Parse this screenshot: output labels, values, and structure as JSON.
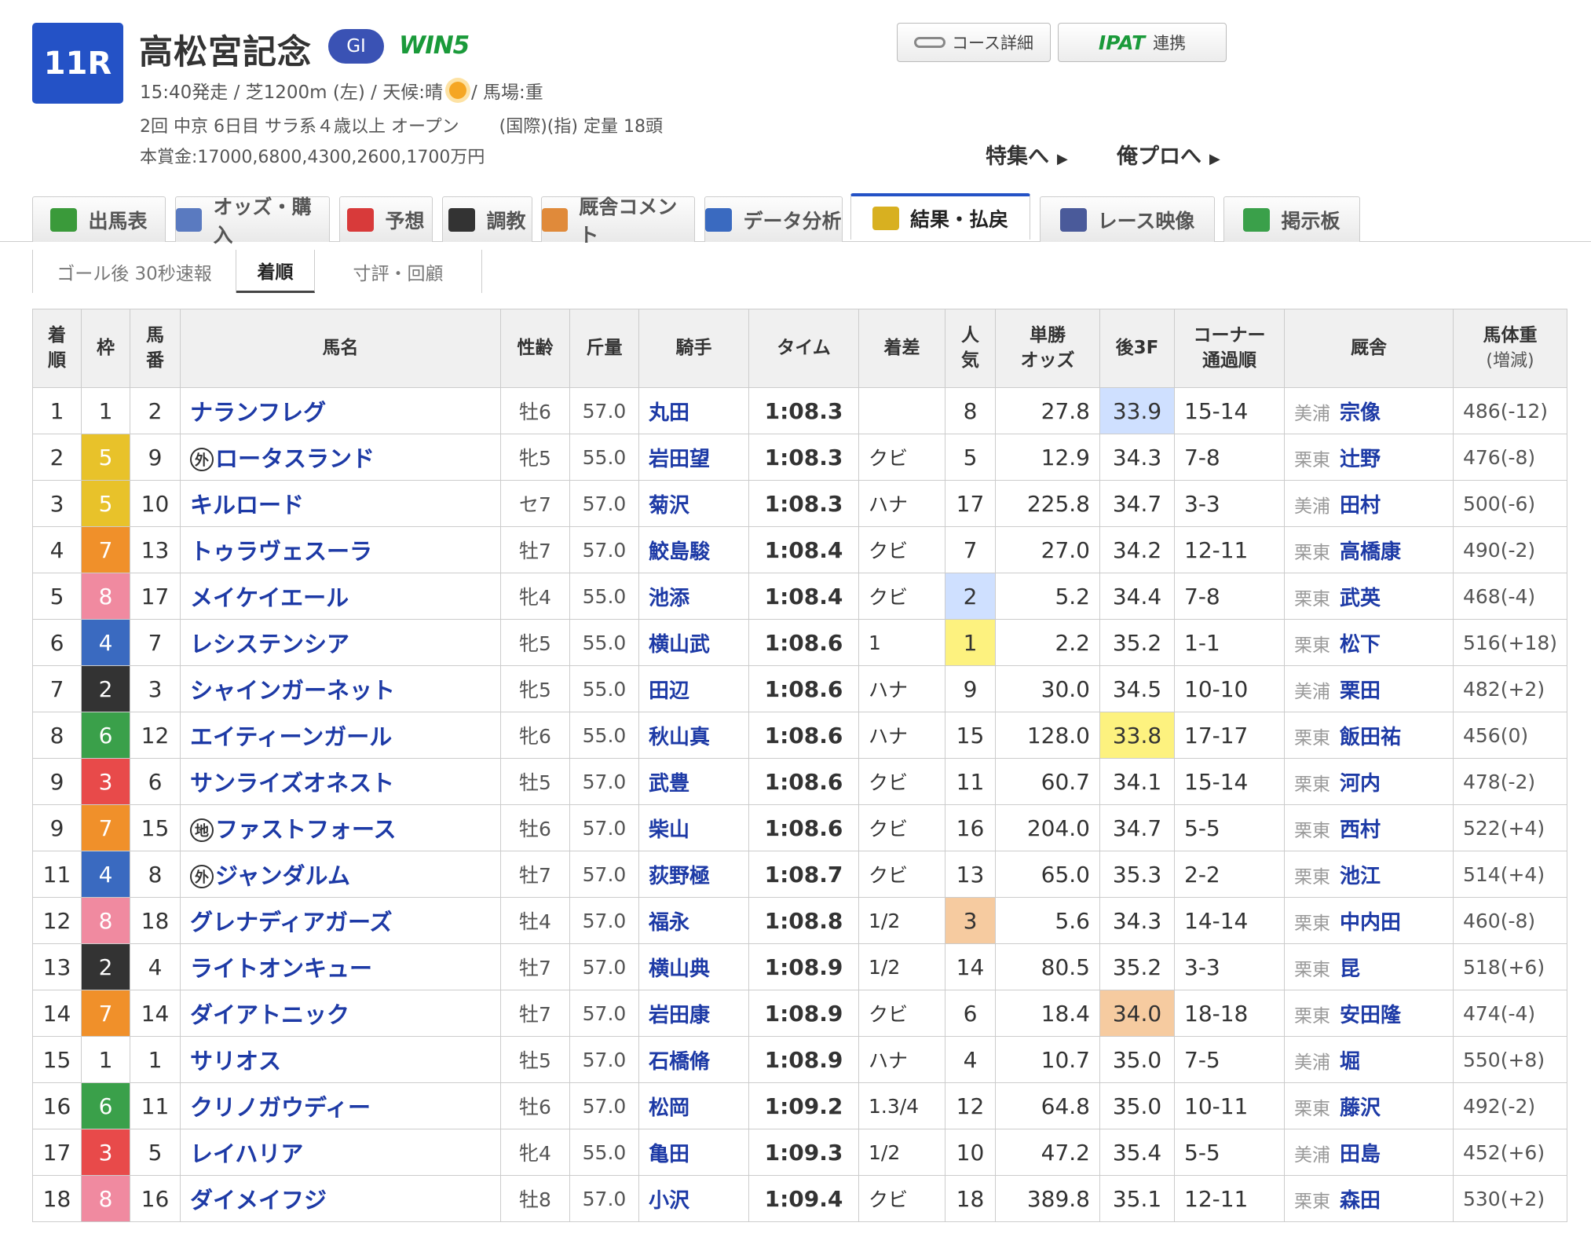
{
  "race": {
    "number": "11R",
    "title": "高松宮記念",
    "grade": "GI",
    "win5": "WIN5",
    "info_start": "15:40発走 / 芝1200m (左) / 天候:晴",
    "weather_icon": "sun-icon",
    "info_track": " / 馬場:重",
    "conditions": "2回 中京 6日目 サラ系４歳以上 オープン 　　(国際)(指) 定量 18頭",
    "prize": "本賞金:17000,6800,4300,2600,1700万円"
  },
  "buttons": {
    "course": "コース詳細",
    "ipat_logo": "IPAT",
    "ipat": "連携",
    "tokushu": "特集へ",
    "orepro": "俺プロへ"
  },
  "tabs": [
    {
      "label": "出馬表",
      "icon": "entry-table-icon",
      "color": "#3a9a3a"
    },
    {
      "label": "オッズ・購入",
      "icon": "odds-icon",
      "color": "#5a7ac0"
    },
    {
      "label": "予想",
      "icon": "target-icon",
      "color": "#d83a3a"
    },
    {
      "label": "調教",
      "icon": "stopwatch-icon",
      "color": "#333333"
    },
    {
      "label": "厩舎コメント",
      "icon": "stable-icon",
      "color": "#e08a3a"
    },
    {
      "label": "データ分析",
      "icon": "bar-chart-icon",
      "color": "#3a6ac0"
    },
    {
      "label": "結果・払戻",
      "icon": "coins-icon",
      "color": "#d8b020"
    },
    {
      "label": "レース映像",
      "icon": "video-icon",
      "color": "#4a5a9a"
    },
    {
      "label": "掲示板",
      "icon": "chat-icon",
      "color": "#3aa04a"
    }
  ],
  "subtabs": [
    "ゴール後 30秒速報",
    "着順",
    "寸評・回顧"
  ],
  "table": {
    "headers": {
      "rank": [
        "着",
        "順"
      ],
      "waku": "枠",
      "num": [
        "馬",
        "番"
      ],
      "horse": "馬名",
      "sexage": "性齢",
      "weight": "斤量",
      "jockey": "騎手",
      "time": "タイム",
      "margin": "着差",
      "pop": [
        "人",
        "気"
      ],
      "odds": [
        "単勝",
        "オッズ"
      ],
      "last3f": "後3F",
      "corner": [
        "コーナー",
        "通過順"
      ],
      "trainer": "厩舎",
      "body": [
        "馬体重",
        "(増減)"
      ]
    },
    "waku_colors": {
      "1": {
        "bg": "#ffffff",
        "fg": "#333333"
      },
      "2": {
        "bg": "#333333",
        "fg": "#ffffff"
      },
      "3": {
        "bg": "#e84a4a",
        "fg": "#ffffff"
      },
      "4": {
        "bg": "#3a6ac0",
        "fg": "#ffffff"
      },
      "5": {
        "bg": "#e8c22a",
        "fg": "#ffffff"
      },
      "6": {
        "bg": "#3aa04a",
        "fg": "#ffffff"
      },
      "7": {
        "bg": "#f0902a",
        "fg": "#ffffff"
      },
      "8": {
        "bg": "#f08aa0",
        "fg": "#ffffff"
      }
    },
    "rows": [
      {
        "rank": "1",
        "waku": "1",
        "num": "2",
        "mark": "",
        "horse": "ナランフレグ",
        "sexage": "牡6",
        "weight": "57.0",
        "jockey": "丸田",
        "time": "1:08.3",
        "margin": "",
        "pop": "8",
        "odds": "27.8",
        "last3f": "33.9",
        "corner": "15-14",
        "area": "美浦",
        "trainer": "宗像",
        "body": "486(-12)"
      },
      {
        "rank": "2",
        "waku": "5",
        "num": "9",
        "mark": "外",
        "horse": "ロータスランド",
        "sexage": "牝5",
        "weight": "55.0",
        "jockey": "岩田望",
        "time": "1:08.3",
        "margin": "クビ",
        "pop": "5",
        "odds": "12.9",
        "last3f": "34.3",
        "corner": "7-8",
        "area": "栗東",
        "trainer": "辻野",
        "body": "476(-8)"
      },
      {
        "rank": "3",
        "waku": "5",
        "num": "10",
        "mark": "",
        "horse": "キルロード",
        "sexage": "セ7",
        "weight": "57.0",
        "jockey": "菊沢",
        "time": "1:08.3",
        "margin": "ハナ",
        "pop": "17",
        "odds": "225.8",
        "last3f": "34.7",
        "corner": "3-3",
        "area": "美浦",
        "trainer": "田村",
        "body": "500(-6)"
      },
      {
        "rank": "4",
        "waku": "7",
        "num": "13",
        "mark": "",
        "horse": "トゥラヴェスーラ",
        "sexage": "牡7",
        "weight": "57.0",
        "jockey": "鮫島駿",
        "time": "1:08.4",
        "margin": "クビ",
        "pop": "7",
        "odds": "27.0",
        "last3f": "34.2",
        "corner": "12-11",
        "area": "栗東",
        "trainer": "高橋康",
        "body": "490(-2)"
      },
      {
        "rank": "5",
        "waku": "8",
        "num": "17",
        "mark": "",
        "horse": "メイケイエール",
        "sexage": "牝4",
        "weight": "55.0",
        "jockey": "池添",
        "time": "1:08.4",
        "margin": "クビ",
        "pop": "2",
        "odds": "5.2",
        "last3f": "34.4",
        "corner": "7-8",
        "area": "栗東",
        "trainer": "武英",
        "body": "468(-4)"
      },
      {
        "rank": "6",
        "waku": "4",
        "num": "7",
        "mark": "",
        "horse": "レシステンシア",
        "sexage": "牝5",
        "weight": "55.0",
        "jockey": "横山武",
        "time": "1:08.6",
        "margin": "1",
        "pop": "1",
        "odds": "2.2",
        "last3f": "35.2",
        "corner": "1-1",
        "area": "栗東",
        "trainer": "松下",
        "body": "516(+18)"
      },
      {
        "rank": "7",
        "waku": "2",
        "num": "3",
        "mark": "",
        "horse": "シャインガーネット",
        "sexage": "牝5",
        "weight": "55.0",
        "jockey": "田辺",
        "time": "1:08.6",
        "margin": "ハナ",
        "pop": "9",
        "odds": "30.0",
        "last3f": "34.5",
        "corner": "10-10",
        "area": "美浦",
        "trainer": "栗田",
        "body": "482(+2)"
      },
      {
        "rank": "8",
        "waku": "6",
        "num": "12",
        "mark": "",
        "horse": "エイティーンガール",
        "sexage": "牝6",
        "weight": "55.0",
        "jockey": "秋山真",
        "time": "1:08.6",
        "margin": "ハナ",
        "pop": "15",
        "odds": "128.0",
        "last3f": "33.8",
        "corner": "17-17",
        "area": "栗東",
        "trainer": "飯田祐",
        "body": "456(0)"
      },
      {
        "rank": "9",
        "waku": "3",
        "num": "6",
        "mark": "",
        "horse": "サンライズオネスト",
        "sexage": "牡5",
        "weight": "57.0",
        "jockey": "武豊",
        "time": "1:08.6",
        "margin": "クビ",
        "pop": "11",
        "odds": "60.7",
        "last3f": "34.1",
        "corner": "15-14",
        "area": "栗東",
        "trainer": "河内",
        "body": "478(-2)"
      },
      {
        "rank": "9",
        "waku": "7",
        "num": "15",
        "mark": "地",
        "horse": "ファストフォース",
        "sexage": "牡6",
        "weight": "57.0",
        "jockey": "柴山",
        "time": "1:08.6",
        "margin": "クビ",
        "pop": "16",
        "odds": "204.0",
        "last3f": "34.7",
        "corner": "5-5",
        "area": "栗東",
        "trainer": "西村",
        "body": "522(+4)"
      },
      {
        "rank": "11",
        "waku": "4",
        "num": "8",
        "mark": "外",
        "horse": "ジャンダルム",
        "sexage": "牡7",
        "weight": "57.0",
        "jockey": "荻野極",
        "time": "1:08.7",
        "margin": "クビ",
        "pop": "13",
        "odds": "65.0",
        "last3f": "35.3",
        "corner": "2-2",
        "area": "栗東",
        "trainer": "池江",
        "body": "514(+4)"
      },
      {
        "rank": "12",
        "waku": "8",
        "num": "18",
        "mark": "",
        "horse": "グレナディアガーズ",
        "sexage": "牡4",
        "weight": "57.0",
        "jockey": "福永",
        "time": "1:08.8",
        "margin": "1/2",
        "pop": "3",
        "odds": "5.6",
        "last3f": "34.3",
        "corner": "14-14",
        "area": "栗東",
        "trainer": "中内田",
        "body": "460(-8)"
      },
      {
        "rank": "13",
        "waku": "2",
        "num": "4",
        "mark": "",
        "horse": "ライトオンキュー",
        "sexage": "牡7",
        "weight": "57.0",
        "jockey": "横山典",
        "time": "1:08.9",
        "margin": "1/2",
        "pop": "14",
        "odds": "80.5",
        "last3f": "35.2",
        "corner": "3-3",
        "area": "栗東",
        "trainer": "昆",
        "body": "518(+6)"
      },
      {
        "rank": "14",
        "waku": "7",
        "num": "14",
        "mark": "",
        "horse": "ダイアトニック",
        "sexage": "牡7",
        "weight": "57.0",
        "jockey": "岩田康",
        "time": "1:08.9",
        "margin": "クビ",
        "pop": "6",
        "odds": "18.4",
        "last3f": "34.0",
        "corner": "18-18",
        "area": "栗東",
        "trainer": "安田隆",
        "body": "474(-4)"
      },
      {
        "rank": "15",
        "waku": "1",
        "num": "1",
        "mark": "",
        "horse": "サリオス",
        "sexage": "牡5",
        "weight": "57.0",
        "jockey": "石橋脩",
        "time": "1:08.9",
        "margin": "ハナ",
        "pop": "4",
        "odds": "10.7",
        "last3f": "35.0",
        "corner": "7-5",
        "area": "美浦",
        "trainer": "堀",
        "body": "550(+8)"
      },
      {
        "rank": "16",
        "waku": "6",
        "num": "11",
        "mark": "",
        "horse": "クリノガウディー",
        "sexage": "牡6",
        "weight": "57.0",
        "jockey": "松岡",
        "time": "1:09.2",
        "margin": "1.3/4",
        "pop": "12",
        "odds": "64.8",
        "last3f": "35.0",
        "corner": "10-11",
        "area": "栗東",
        "trainer": "藤沢",
        "body": "492(-2)"
      },
      {
        "rank": "17",
        "waku": "3",
        "num": "5",
        "mark": "",
        "horse": "レイハリア",
        "sexage": "牝4",
        "weight": "55.0",
        "jockey": "亀田",
        "time": "1:09.3",
        "margin": "1/2",
        "pop": "10",
        "odds": "47.2",
        "last3f": "35.4",
        "corner": "5-5",
        "area": "美浦",
        "trainer": "田島",
        "body": "452(+6)"
      },
      {
        "rank": "18",
        "waku": "8",
        "num": "16",
        "mark": "",
        "horse": "ダイメイフジ",
        "sexage": "牡8",
        "weight": "57.0",
        "jockey": "小沢",
        "time": "1:09.4",
        "margin": "クビ",
        "pop": "18",
        "odds": "389.8",
        "last3f": "35.1",
        "corner": "12-11",
        "area": "栗東",
        "trainer": "森田",
        "body": "530(+2)"
      }
    ],
    "highlights": {
      "pop": {
        "1": "bg-yellow",
        "2": "bg-blue",
        "3": "bg-orange"
      },
      "last3f_rank": {
        "1": "bg-yellow",
        "2": "bg-blue",
        "3": "bg-orange"
      },
      "last3f_top": [
        "33.8",
        "33.9",
        "34.0"
      ],
      "red_odds_pops": [
        "1",
        "2",
        "3"
      ]
    }
  }
}
